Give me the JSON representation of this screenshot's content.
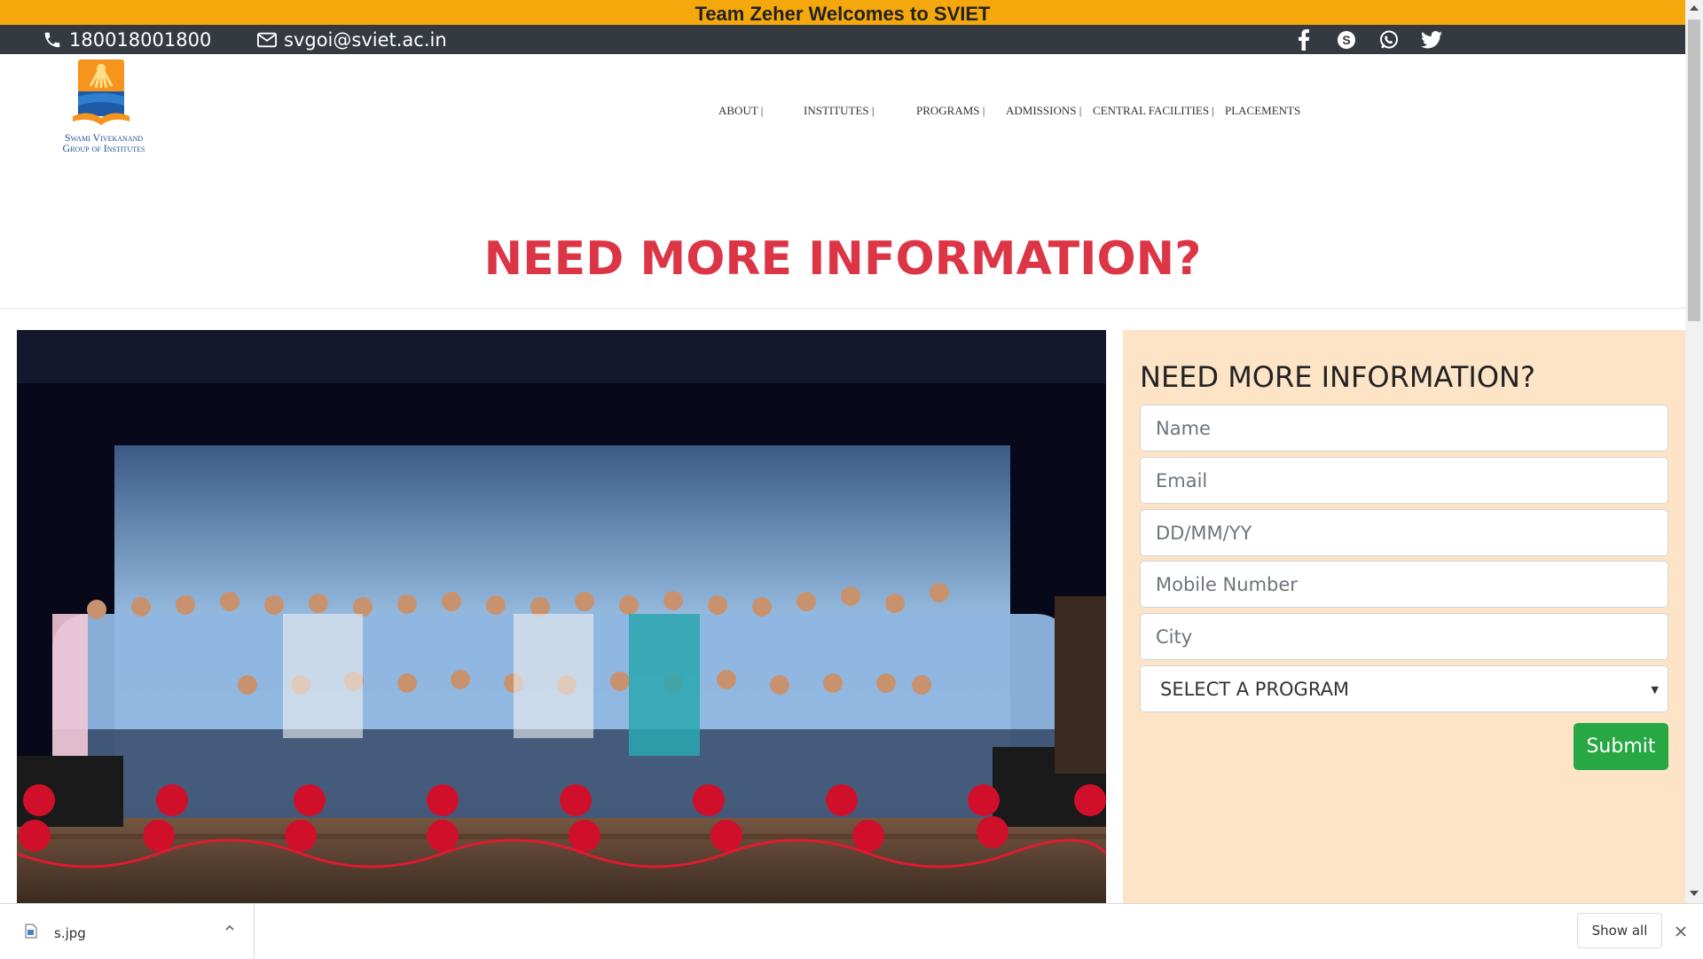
{
  "banner": {
    "text": "Team Zeher Welcomes to SVIET"
  },
  "contact": {
    "phone": "180018001800",
    "email": "svgoi@sviet.ac.in",
    "social": [
      "facebook-icon",
      "skype-icon",
      "whatsapp-icon",
      "twitter-icon"
    ]
  },
  "logo": {
    "line1": "Swami Vivekanand",
    "line2": "Group of Institutes"
  },
  "nav": {
    "items": [
      {
        "label": "ABOUT |"
      },
      {
        "label": "INSTITUTES |"
      },
      {
        "label": "PROGRAMS |"
      },
      {
        "label": "ADMISSIONS |"
      },
      {
        "label": "CENTRAL FACILITIES |"
      },
      {
        "label": "PLACEMENTS"
      }
    ]
  },
  "hero": {
    "title": "NEED MORE INFORMATION?"
  },
  "form": {
    "title": "NEED MORE INFORMATION?",
    "name_placeholder": "Name",
    "email_placeholder": "Email",
    "dob_placeholder": "DD/MM/YY",
    "mobile_placeholder": "Mobile Number",
    "city_placeholder": "City",
    "program_selected": "SELECT A PROGRAM",
    "submit_label": "Submit"
  },
  "downloads": {
    "file_name": "s.jpg",
    "show_all_label": "Show all"
  },
  "colors": {
    "banner": "#f5a80b",
    "contact_bar": "#343a40",
    "hero_red": "#dc3545",
    "form_bg": "#fde4c6",
    "submit_green": "#28a745"
  }
}
